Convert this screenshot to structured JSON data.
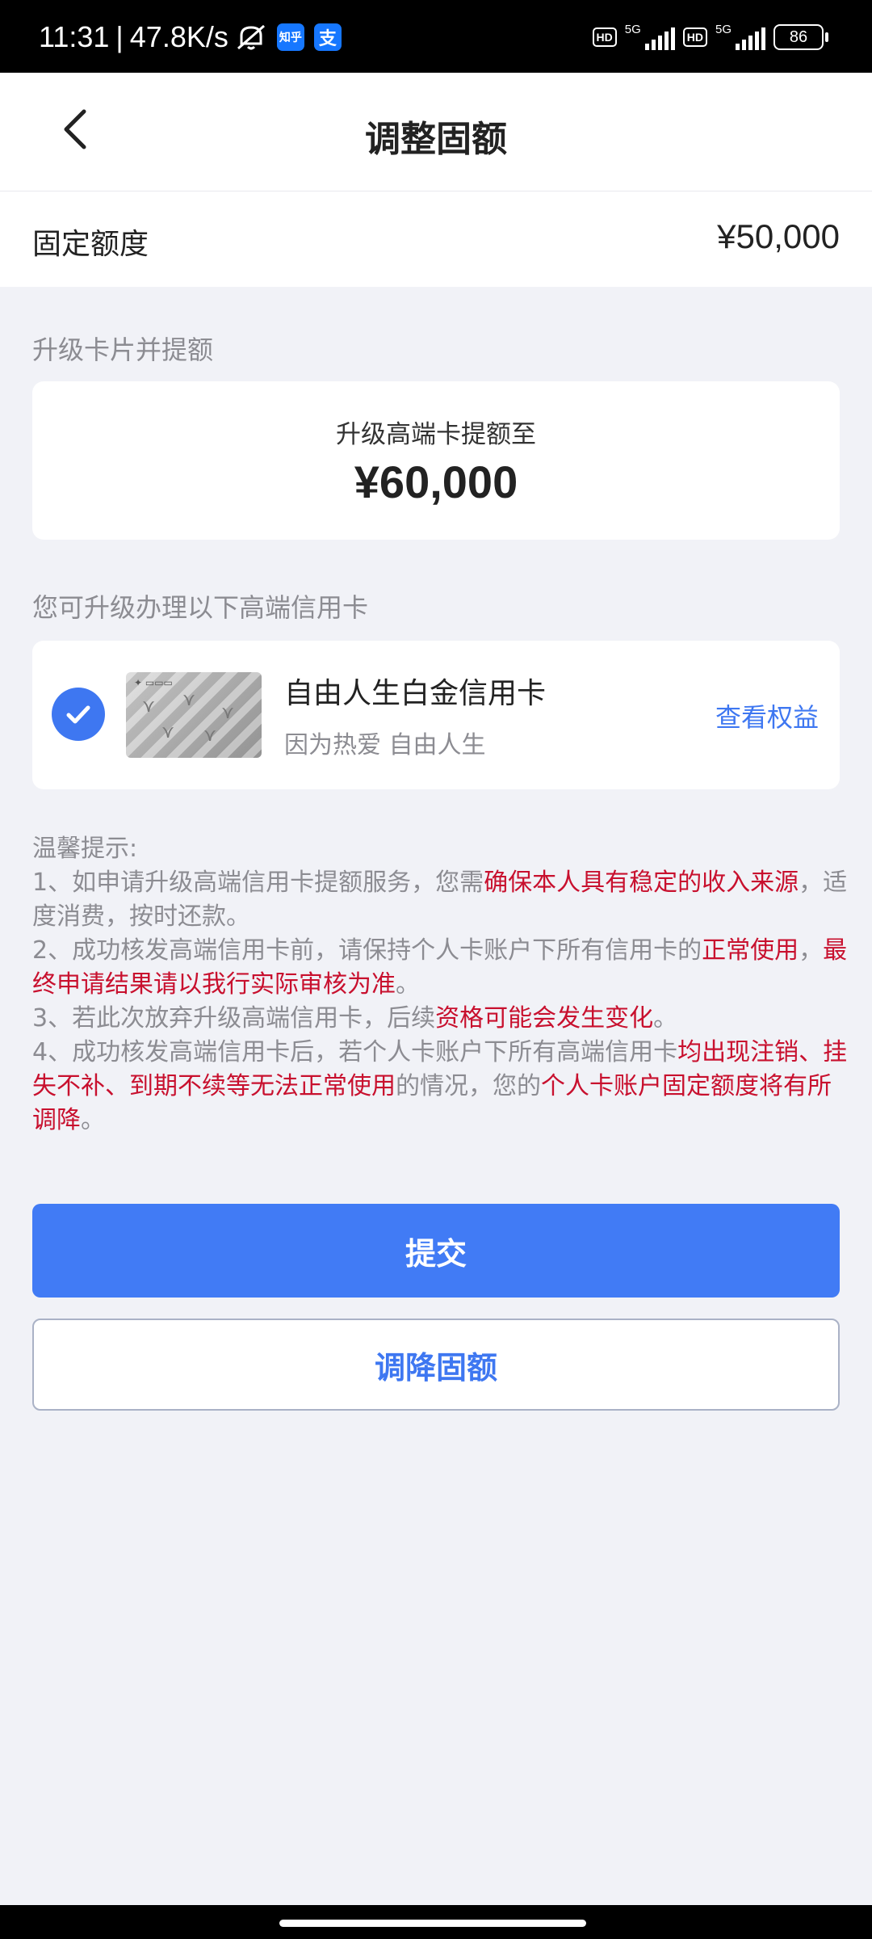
{
  "status_bar": {
    "time": "11:31",
    "separator": "|",
    "speed": "47.8K/s",
    "app1_label": "知乎",
    "app1_color": "#1677ff",
    "app2_label": "支",
    "app2_color": "#1677ff",
    "hd1": "HD",
    "net1": "5G",
    "hd2": "HD",
    "net2": "5G",
    "battery": "86",
    "icons": [
      "mute-icon",
      "zhihu-app-icon",
      "alipay-app-icon",
      "hd-icon",
      "signal-icon",
      "battery-icon"
    ]
  },
  "header": {
    "title": "调整固额",
    "back_icon": "chevron-left-icon"
  },
  "fixed": {
    "label": "固定额度",
    "value": "¥50,000"
  },
  "upgrade": {
    "section_label": "升级卡片并提额",
    "subtitle": "升级高端卡提额至",
    "amount": "¥60,000"
  },
  "options": {
    "section_label": "您可升级办理以下高端信用卡",
    "card_name": "自由人生白金信用卡",
    "slogan": "因为热爱 自由人生",
    "link": "查看权益",
    "selected": true,
    "accent": "#3e77f1"
  },
  "tips": {
    "title": "温馨提示:",
    "t1_a": "1、如申请升级高端信用卡提额服务，您需",
    "t1_b": "确保本人具有稳定的收入来源",
    "t1_c": "，适度消费，按时还款。",
    "t2_a": "2、成功核发高端信用卡前，请保持个人卡账户下所有信用卡的",
    "t2_b": "正常使用",
    "t2_c": "，",
    "t2_d": "最终申请结果请以我行实际审核为准",
    "t2_e": "。",
    "t3_a": "3、若此次放弃升级高端信用卡，后续",
    "t3_b": "资格可能会发生变化",
    "t3_c": "。",
    "t4_a": "4、成功核发高端信用卡后，若个人卡账户下所有高端信用卡",
    "t4_b": "均出现注销、挂失不补、到期不续等无法正常使用",
    "t4_c": "的情况，您的",
    "t4_d": "个人卡账户固定额度将有所调降",
    "t4_e": "。",
    "highlight_color": "#c8102e"
  },
  "buttons": {
    "submit": "提交",
    "lower": "调降固额",
    "primary_color": "#417bf5"
  }
}
